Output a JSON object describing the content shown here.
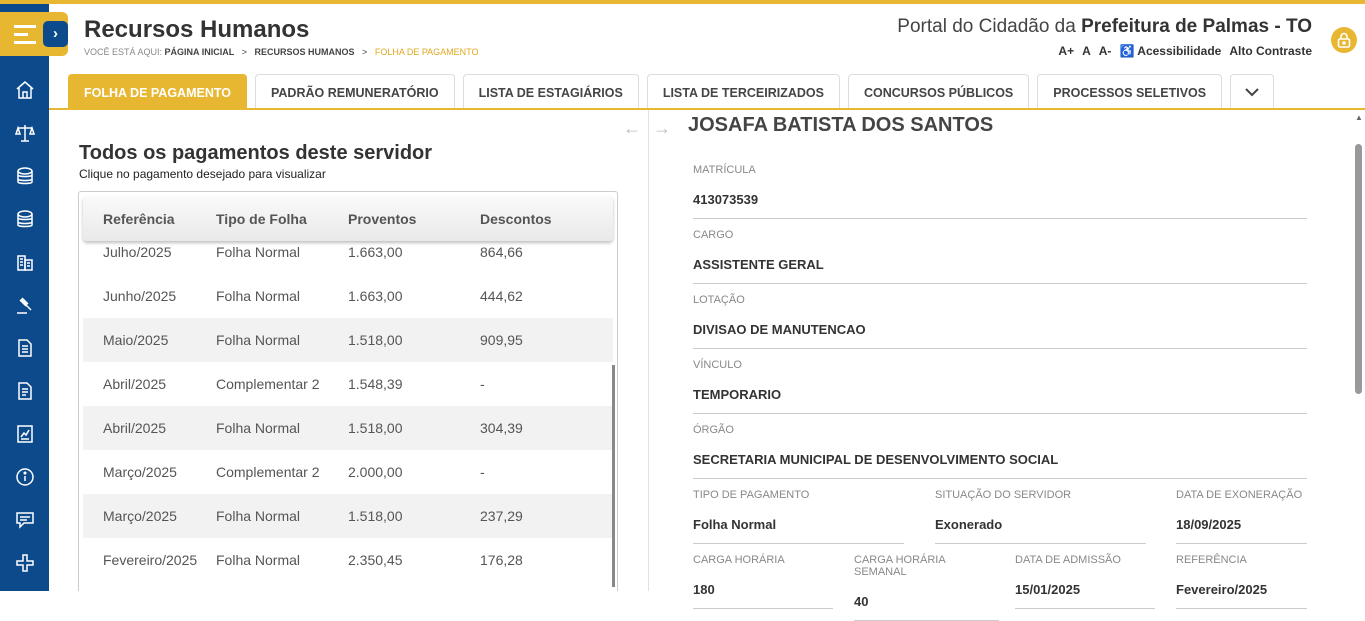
{
  "header": {
    "title": "Recursos Humanos",
    "breadcrumb": {
      "prefix": "VOCÊ ESTÁ AQUI:",
      "items": [
        "PÁGINA INICIAL",
        "RECURSOS HUMANOS",
        "FOLHA DE PAGAMENTO"
      ],
      "separator": ">"
    },
    "portal_prefix": "Portal do Cidadão da ",
    "portal_bold": "Prefeitura de Palmas - TO",
    "accessibility": {
      "font_increase": "A+",
      "font_reset": "A",
      "font_decrease": "A-",
      "accessibility_label": "Acessibilidade",
      "contrast_label": "Alto Contraste"
    }
  },
  "sidebar": {
    "icons": [
      "home-icon",
      "scales-icon",
      "coins-icon",
      "coins-stack-icon",
      "buildings-icon",
      "gavel-icon",
      "document-icon",
      "document-list-icon",
      "chart-report-icon",
      "info-icon",
      "chat-icon",
      "plus-cross-icon"
    ]
  },
  "tabs": [
    {
      "label": "FOLHA DE PAGAMENTO",
      "active": true
    },
    {
      "label": "PADRÃO REMUNERATÓRIO",
      "active": false
    },
    {
      "label": "LISTA DE ESTAGIÁRIOS",
      "active": false
    },
    {
      "label": "LISTA DE TERCEIRIZADOS",
      "active": false
    },
    {
      "label": "CONCURSOS PÚBLICOS",
      "active": false
    },
    {
      "label": "PROCESSOS SELETIVOS",
      "active": false
    }
  ],
  "payments": {
    "title": "Todos os pagamentos deste servidor",
    "subtitle": "Clique no pagamento desejado para visualizar",
    "columns": [
      "Referência",
      "Tipo de Folha",
      "Proventos",
      "Descontos"
    ],
    "rows": [
      [
        "Julho/2025",
        "Folha Normal",
        "1.663,00",
        "864,66"
      ],
      [
        "Junho/2025",
        "Folha Normal",
        "1.663,00",
        "444,62"
      ],
      [
        "Maio/2025",
        "Folha Normal",
        "1.518,00",
        "909,95"
      ],
      [
        "Abril/2025",
        "Complementar 2",
        "1.548,39",
        "-"
      ],
      [
        "Abril/2025",
        "Folha Normal",
        "1.518,00",
        "304,39"
      ],
      [
        "Março/2025",
        "Complementar 2",
        "2.000,00",
        "-"
      ],
      [
        "Março/2025",
        "Folha Normal",
        "1.518,00",
        "237,29"
      ],
      [
        "Fevereiro/2025",
        "Folha Normal",
        "2.350,45",
        "176,28"
      ]
    ]
  },
  "employee": {
    "name": "JOSAFA BATISTA DOS SANTOS",
    "matricula_label": "MATRÍCULA",
    "matricula": "413073539",
    "cargo_label": "CARGO",
    "cargo": "ASSISTENTE GERAL",
    "lotacao_label": "LOTAÇÃO",
    "lotacao": "DIVISAO DE MANUTENCAO",
    "vinculo_label": "VÍNCULO",
    "vinculo": "TEMPORARIO",
    "orgao_label": "ÓRGÃO",
    "orgao": "SECRETARIA MUNICIPAL DE DESENVOLVIMENTO SOCIAL",
    "tipo_pagamento_label": "TIPO DE PAGAMENTO",
    "tipo_pagamento": "Folha Normal",
    "situacao_label": "SITUAÇÃO DO SERVIDOR",
    "situacao": "Exonerado",
    "exoneracao_label": "DATA DE EXONERAÇÃO",
    "exoneracao": "18/09/2025",
    "carga_horaria_label": "CARGA HORÁRIA",
    "carga_horaria": "180",
    "carga_semanal_label": "CARGA HORÁRIA SEMANAL",
    "carga_semanal": "40",
    "admissao_label": "DATA DE ADMISSÃO",
    "admissao": "15/01/2025",
    "referencia_label": "REFERÊNCIA",
    "referencia": "Fevereiro/2025"
  },
  "colors": {
    "accent": "#e8b731",
    "sidebar": "#0c4a8b"
  }
}
